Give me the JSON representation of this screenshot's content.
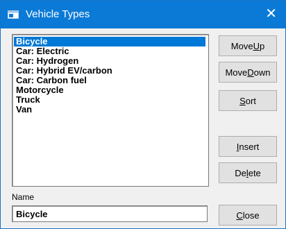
{
  "window": {
    "title": "Vehicle Types",
    "close_glyph": "✕",
    "icon": "app-window-icon",
    "title_bar_color": "#0a7ad6"
  },
  "list": {
    "selected_index": 0,
    "selection_color": "#0078d7",
    "items": [
      "Bicycle",
      "Car: Electric",
      "Car: Hydrogen",
      "Car: Hybrid EV/carbon",
      "Car: Carbon fuel",
      "Motorcycle",
      "Truck",
      "Van"
    ]
  },
  "buttons": {
    "move_up": {
      "pre": "Move ",
      "key": "U",
      "post": "p"
    },
    "move_down": {
      "pre": "Move ",
      "key": "D",
      "post": "own"
    },
    "sort": {
      "pre": "",
      "key": "S",
      "post": "ort"
    },
    "insert": {
      "pre": "",
      "key": "I",
      "post": "nsert"
    },
    "delete": {
      "pre": "De",
      "key": "l",
      "post": "ete"
    },
    "close": {
      "pre": "",
      "key": "C",
      "post": "lose"
    }
  },
  "name_field": {
    "label": "Name",
    "value": "Bicycle"
  }
}
